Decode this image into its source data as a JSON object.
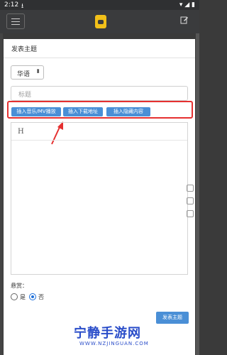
{
  "status_bar": {
    "time": "2:12"
  },
  "header": {
    "logo_name": "app-logo"
  },
  "form": {
    "section_title": "发表主题",
    "language_select_value": "华语",
    "title_placeholder": "标题",
    "insert_buttons": [
      "插入音乐/MV播放",
      "插入下载地址",
      "插入隐藏内容"
    ],
    "editor_heading_tool": "H",
    "reward_label": "悬赏：",
    "reward_options": [
      "是",
      "否"
    ],
    "reward_selected": "否",
    "submit_label": "发表主题"
  },
  "watermark": {
    "title": "宁静手游网",
    "url": "WWW.NZJINGUAN.COM"
  },
  "colors": {
    "accent": "#4a8fd6",
    "highlight": "#e53030",
    "watermark": "#2a4dc9"
  }
}
